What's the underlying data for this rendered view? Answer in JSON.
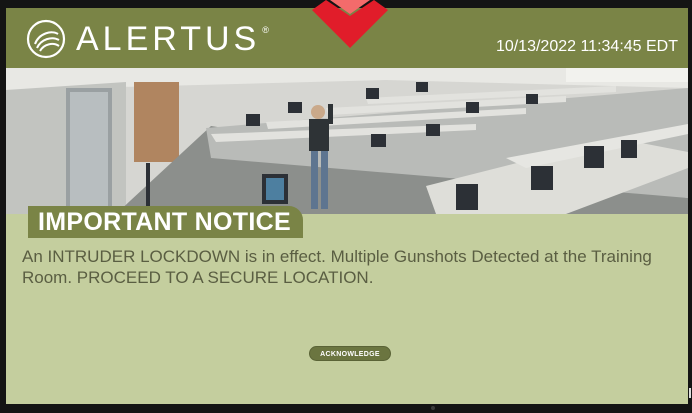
{
  "app": {
    "brand": "ALERTUS",
    "registered_mark": "®",
    "datetime": "10/13/2022 11:34:45 EDT"
  },
  "notice": {
    "heading": "IMPORTANT NOTICE",
    "message": "An INTRUDER LOCKDOWN is in effect. Multiple Gunshots Detected at the Training Room. PROCEED TO A SECURE LOCATION."
  },
  "actions": {
    "acknowledge_label": "ACKNOWLEDGE"
  },
  "colors": {
    "header_bar": "#7a8446",
    "body_background": "#c4ce9e",
    "message_text": "#5a5e42",
    "button": "#6b7540",
    "beacon": "#e11d2a"
  },
  "icons": {
    "brand_logo": "alertus-logo-icon",
    "beacon": "alert-beacon-icon"
  }
}
